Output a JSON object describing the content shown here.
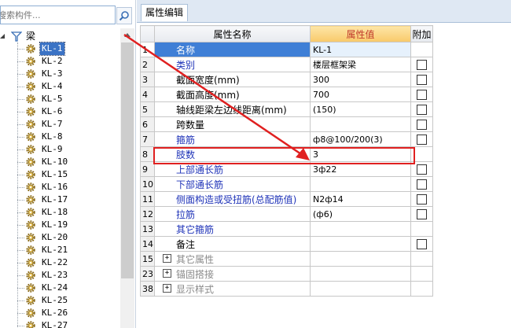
{
  "search": {
    "placeholder": "搜索构件..."
  },
  "tree": {
    "root_label": "梁",
    "items": [
      "KL-1",
      "KL-2",
      "KL-3",
      "KL-4",
      "KL-5",
      "KL-6",
      "KL-7",
      "KL-8",
      "KL-9",
      "KL-10",
      "KL-15",
      "KL-16",
      "KL-17",
      "KL-18",
      "KL-19",
      "KL-20",
      "KL-21",
      "KL-22",
      "KL-23",
      "KL-24",
      "KL-25",
      "KL-26",
      "KL-27"
    ],
    "selected": "KL-1"
  },
  "tab": {
    "label": "属性编辑"
  },
  "grid": {
    "headers": {
      "name": "属性名称",
      "value": "属性值",
      "extra": "附加"
    },
    "rows": [
      {
        "num": "1",
        "name": "名称",
        "value": "KL-1",
        "checkbox": false,
        "blue": true,
        "selected": true
      },
      {
        "num": "2",
        "name": "类别",
        "value": "楼层框架梁",
        "checkbox": true,
        "blue": true
      },
      {
        "num": "3",
        "name": "截面宽度(mm)",
        "value": "300",
        "checkbox": true,
        "blue": false
      },
      {
        "num": "4",
        "name": "截面高度(mm)",
        "value": "700",
        "checkbox": true,
        "blue": false
      },
      {
        "num": "5",
        "name": "轴线距梁左边线距离(mm)",
        "value": "(150)",
        "checkbox": true,
        "blue": false
      },
      {
        "num": "6",
        "name": "跨数量",
        "value": "",
        "checkbox": true,
        "blue": false
      },
      {
        "num": "7",
        "name": "箍筋",
        "value": "ф8@100/200(3)",
        "checkbox": true,
        "blue": true
      },
      {
        "num": "8",
        "name": "肢数",
        "value": "3",
        "checkbox": false,
        "blue": true
      },
      {
        "num": "9",
        "name": "上部通长筋",
        "value": "3ф22",
        "checkbox": true,
        "blue": true
      },
      {
        "num": "10",
        "name": "下部通长筋",
        "value": "",
        "checkbox": true,
        "blue": true
      },
      {
        "num": "11",
        "name": "侧面构造或受扭筋(总配筋值)",
        "value": "N2ф14",
        "checkbox": true,
        "blue": true
      },
      {
        "num": "12",
        "name": "拉筋",
        "value": "(ф6)",
        "checkbox": true,
        "blue": true
      },
      {
        "num": "13",
        "name": "其它箍筋",
        "value": "",
        "checkbox": false,
        "blue": true
      },
      {
        "num": "14",
        "name": "备注",
        "value": "",
        "checkbox": true,
        "blue": false
      }
    ],
    "groups": [
      {
        "num": "15",
        "name": "其它属性"
      },
      {
        "num": "23",
        "name": "锚固搭接"
      },
      {
        "num": "38",
        "name": "显示样式"
      }
    ]
  },
  "colors": {
    "annotation": "#e02020",
    "selection": "#3f7fd6",
    "header_highlight": "#f8c96a"
  }
}
